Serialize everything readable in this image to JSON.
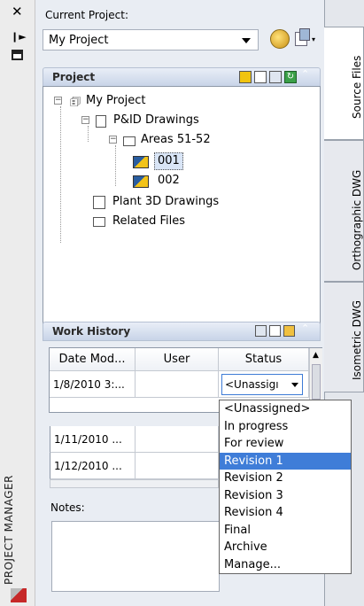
{
  "palette": {
    "panel_bg": "#e9edf3",
    "highlight": "#3f7dd8",
    "header_grad_top": "#e9eef7",
    "header_grad_bottom": "#c8d4e8"
  },
  "header": {
    "current_project_label": "Current Project:",
    "project_value": "My Project"
  },
  "palette_title": "PROJECT MANAGER",
  "tabs": [
    {
      "label": "Source Files",
      "active": true
    },
    {
      "label": "Orthographic DWG",
      "active": false
    },
    {
      "label": "Isometric DWG",
      "active": false
    }
  ],
  "project_panel": {
    "title": "Project"
  },
  "tree": {
    "root": "My Project",
    "pid": "P&ID Drawings",
    "areas": "Areas 51-52",
    "d1": "001",
    "d2": "002",
    "plant3d": "Plant 3D Drawings",
    "related": "Related Files"
  },
  "work_history": {
    "title": "Work History",
    "columns": [
      "Date Mod...",
      "User",
      "Status"
    ],
    "rows": [
      {
        "date": "1/8/2010 3:...",
        "user": "",
        "status": "<Unassigı"
      },
      {
        "date": "1/11/2010 ...",
        "user": "",
        "status": ""
      },
      {
        "date": "1/12/2010 ...",
        "user": "",
        "status": ""
      }
    ],
    "status_options": [
      "<Unassigned>",
      "In progress",
      "For review",
      "Revision 1",
      "Revision 2",
      "Revision 3",
      "Revision 4",
      "Final",
      "Archive",
      "Manage..."
    ],
    "highlighted_index": 3
  },
  "notes": {
    "label": "Notes:"
  }
}
